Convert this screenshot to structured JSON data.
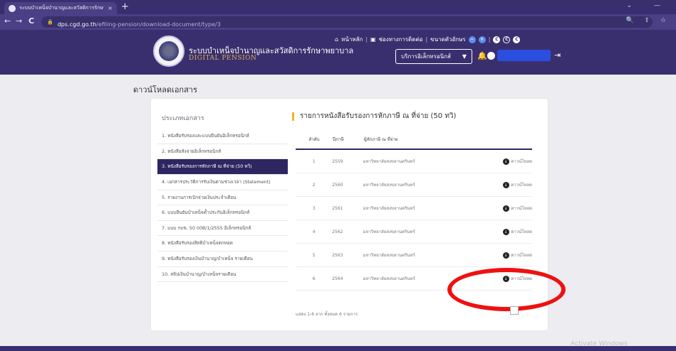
{
  "browser": {
    "tab_title": "ระบบบำเหน็จบำนาญและสวัสดิการรักษาพยาบาล",
    "tab_close": "×",
    "new_tab": "+",
    "window_controls": "⌄ —",
    "back": "←",
    "forward": "→",
    "reload": "C",
    "lock": "🔒",
    "url_host": "dps.cgd.go.th",
    "url_path": "/efiling-pension/download-document/type/3",
    "toolbar_icons": "🔍 ⇪ ☆"
  },
  "header": {
    "title": "ระบบบำเหน็จบำนาญและสวัสดิการรักษาพยาบาล",
    "subtitle": "DIGITAL PENSION",
    "links": {
      "home": "หน้าหลัก",
      "manual": "ช่องทางการติดต่อ",
      "font": "ขนาดตัวอักษร",
      "sep": "|"
    },
    "service_button": "บริการอิเล็กทรอนิกส์",
    "service_caret": "▼",
    "bell": "🔔",
    "logout": "⇥"
  },
  "page": {
    "title": "ดาวน์โหลดเอกสาร"
  },
  "sidebar": {
    "heading": "ประเภทเอกสาร",
    "items": [
      {
        "label": "1. หนังสือรับรองและแบบยืนยันอิเล็กทรอนิกส์"
      },
      {
        "label": "2. หนังสือสั่งจ่ายอิเล็กทรอนิกส์"
      },
      {
        "label": "3. หนังสือรับรองการหักภาษี ณ ที่จ่าย (50 ทวิ)"
      },
      {
        "label": "4. เอกสารประวัติการรับเงินตามช่วงเวลา (Statement)"
      },
      {
        "label": "5. รายงานการเบิกจ่ายเงินประจำเดือน"
      },
      {
        "label": "6. แบบยืนยันบำเหน็จค้ำประกันอิเล็กทรอนิกส์"
      },
      {
        "label": "7. แบบ กบข. 50 008/1/2555 อิเล็กทรอนิกส์"
      },
      {
        "label": "8. หนังสือรับรองสิทธิบำเหน็จตกทอด"
      },
      {
        "label": "9. หนังสือรับรองเงินบำนาญ/บำเหน็จ รายเดือน"
      },
      {
        "label": "10. สลิปเงินบำนาญ/บำเหน็จรายเดือน"
      }
    ],
    "active_index": 2
  },
  "list": {
    "title": "รายการหนังสือรับรองการหักภาษี ณ ที่จ่าย (50 ทวิ)",
    "columns": [
      "ลำดับ",
      "ปีภาษี",
      "ผู้หักภาษี ณ ที่จ่าย"
    ],
    "download_label": "ดาวน์โหลด",
    "download_icon": "↓",
    "rows": [
      {
        "no": "1",
        "year": "2559",
        "payer": "มหาวิทยาลัยสงขลานครินทร์"
      },
      {
        "no": "2",
        "year": "2560",
        "payer": "มหาวิทยาลัยสงขลานครินทร์"
      },
      {
        "no": "3",
        "year": "2561",
        "payer": "มหาวิทยาลัยสงขลานครินทร์"
      },
      {
        "no": "4",
        "year": "2562",
        "payer": "มหาวิทยาลัยสงขลานครินทร์"
      },
      {
        "no": "5",
        "year": "2563",
        "payer": "มหาวิทยาลัยสงขลานครินทร์"
      },
      {
        "no": "6",
        "year": "2564",
        "payer": "มหาวิทยาลัยสงขลานครินทร์"
      }
    ],
    "footer": "แสดง 1-6 จาก ทั้งหมด 6 รายการ"
  },
  "watermark": "Activate Windows"
}
